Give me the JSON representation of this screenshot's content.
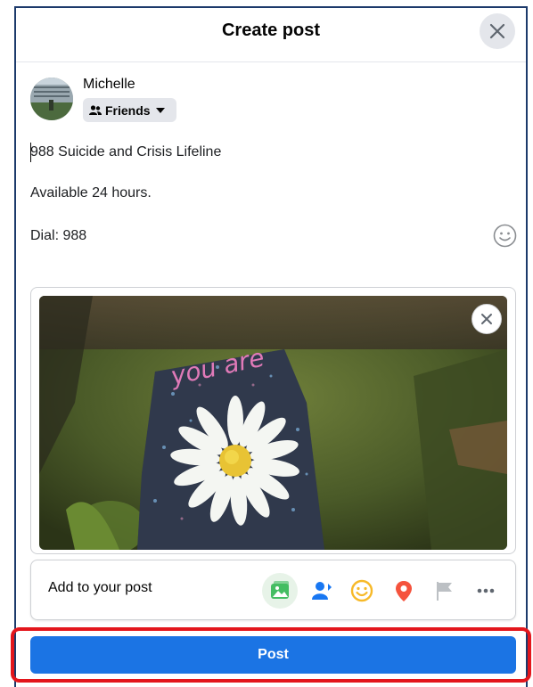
{
  "dialog": {
    "title": "Create post",
    "close_icon": "close-icon"
  },
  "author": {
    "name": "Michelle",
    "audience": "Friends",
    "audience_icon": "friends-icon"
  },
  "composer": {
    "lines": [
      "988 Suicide and Crisis Lifeline",
      "Available 24 hours.",
      "Dial: 988"
    ],
    "emoji_icon": "smiley-icon"
  },
  "attachment": {
    "remove_icon": "close-icon",
    "photo_text": "you are"
  },
  "add_to_post": {
    "label": "Add to your post",
    "icons": [
      "photo-video-icon",
      "tag-people-icon",
      "feeling-icon",
      "check-in-icon",
      "flag-icon",
      "more-icon"
    ],
    "colors": {
      "photo": "#45bd62",
      "tag": "#1877f2",
      "feeling": "#f7b928",
      "checkin": "#f5533d",
      "flag": "#bcc0c4"
    }
  },
  "post_button": {
    "label": "Post",
    "color": "#1b74e4",
    "highlight_color": "#e3161c"
  }
}
